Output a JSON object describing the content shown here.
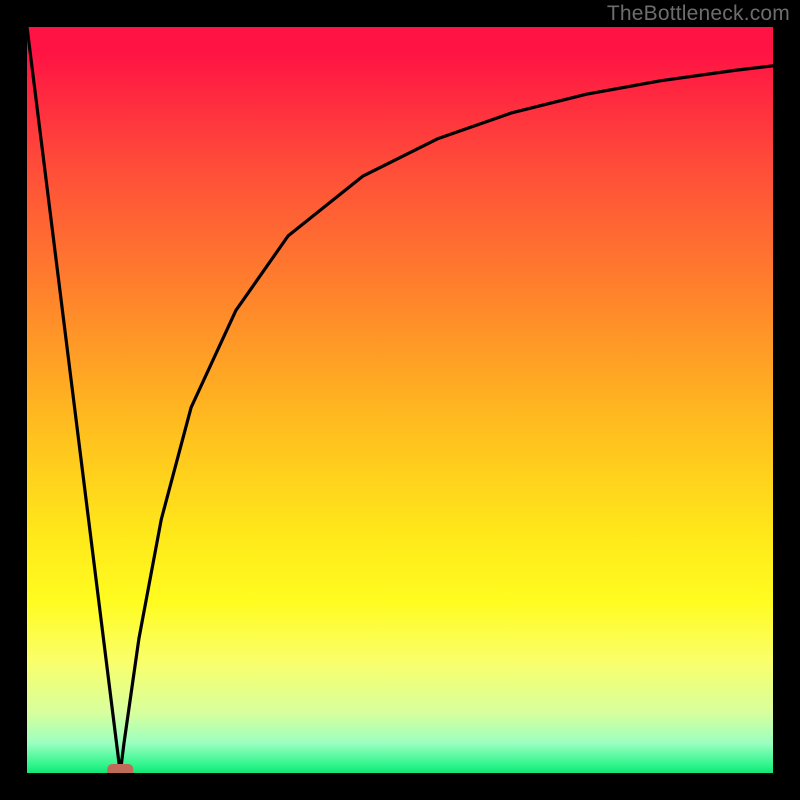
{
  "watermark": "TheBottleneck.com",
  "chart_data": {
    "type": "line",
    "title": "",
    "xlabel": "",
    "ylabel": "",
    "xlim": [
      0,
      100
    ],
    "ylim": [
      0,
      100
    ],
    "grid": false,
    "legend": false,
    "optimum_x": 12.5,
    "marker": {
      "x": 12.5,
      "y": 0,
      "color": "#c06a5a"
    },
    "background_gradient": [
      "#ff1244",
      "#ff8a2a",
      "#ffe81a",
      "#fffc20",
      "#12e676"
    ],
    "series": [
      {
        "name": "bottleneck-curve",
        "x": [
          0,
          2,
          4,
          6,
          8,
          10,
          12,
          12.5,
          13,
          15,
          18,
          22,
          28,
          35,
          45,
          55,
          65,
          75,
          85,
          95,
          100
        ],
        "y": [
          100,
          84,
          68,
          52,
          36,
          20,
          4,
          0,
          4,
          18,
          34,
          49,
          62,
          72,
          80,
          85,
          88.5,
          91,
          92.8,
          94.2,
          94.8
        ]
      }
    ]
  }
}
